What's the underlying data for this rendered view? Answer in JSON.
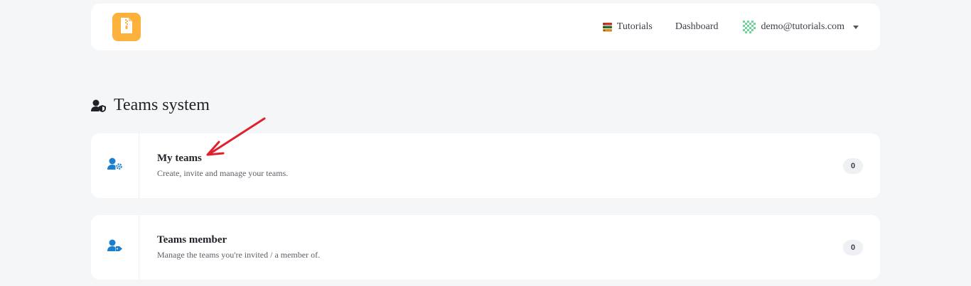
{
  "header": {
    "logo_icon": "zip-file-icon",
    "nav": {
      "tutorials_label": "Tutorials",
      "dashboard_label": "Dashboard",
      "user_email": "demo@tutorials.com"
    }
  },
  "section": {
    "title": "Teams system",
    "icon": "user-shield-icon"
  },
  "cards": [
    {
      "title": "My teams",
      "description": "Create, invite and manage your teams.",
      "count": "0",
      "icon": "user-gear-icon"
    },
    {
      "title": "Teams member",
      "description": "Manage the teams you're invited / a member of.",
      "count": "0",
      "icon": "user-tag-icon"
    }
  ],
  "colors": {
    "accent": "#1b7fcf",
    "logo": "#fbb13c",
    "annotation": "#e0202e",
    "background": "#f5f6f8"
  }
}
